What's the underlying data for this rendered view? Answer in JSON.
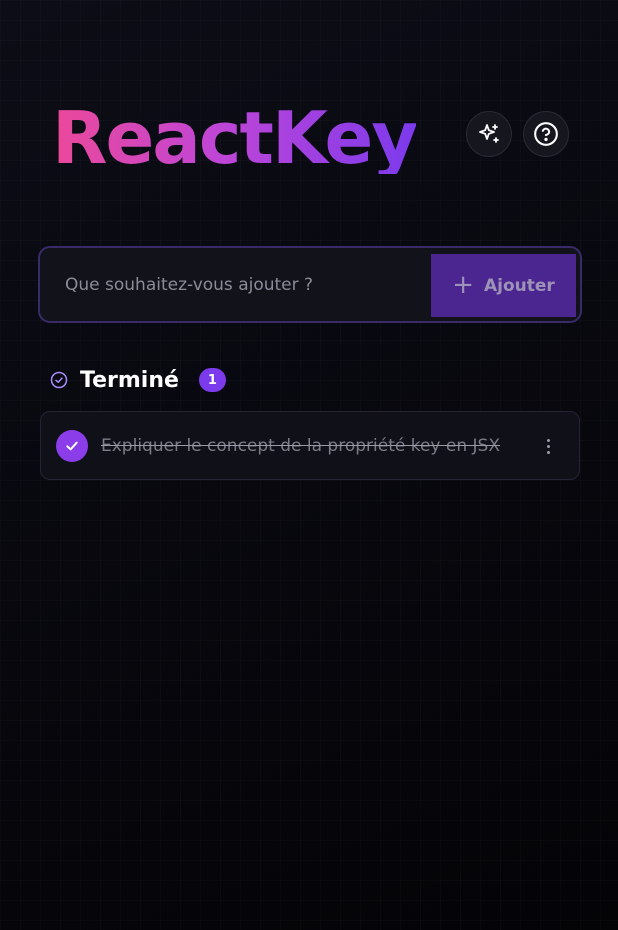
{
  "app": {
    "title": "ReactKey"
  },
  "header": {
    "buttons": [
      {
        "icon": "sparkles-icon"
      },
      {
        "icon": "help-circle-icon"
      }
    ]
  },
  "add_form": {
    "placeholder": "Que souhaitez-vous ajouter ?",
    "value": "",
    "button_label": "Ajouter",
    "button_icon": "plus-icon"
  },
  "completed_section": {
    "title": "Terminé",
    "count": "1",
    "icon": "check-circle-icon",
    "tasks": [
      {
        "text": "Expliquer le concept de la propriété key en JSX",
        "done": true
      }
    ]
  },
  "colors": {
    "accent": "#7c3aed",
    "gradient_start": "#ec4899",
    "gradient_end": "#7c3aed",
    "background": "#08080f",
    "add_button_bg": "#4c2690"
  }
}
